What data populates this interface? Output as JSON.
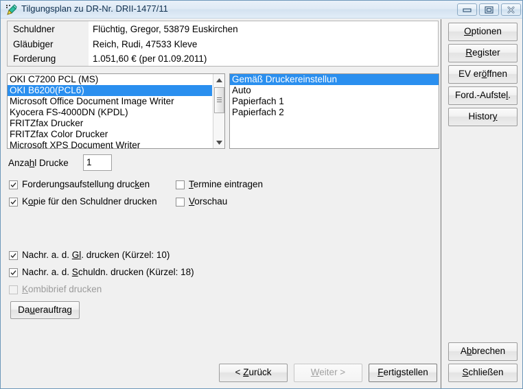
{
  "window": {
    "title": "Tilgungsplan zu DR-Nr. DRII-1477/11",
    "icon": "pen-tool-icon",
    "controls": {
      "minimize": "minimize-icon",
      "maximize": "maximize-icon",
      "close": "close-icon"
    }
  },
  "header": {
    "rows": [
      {
        "label": "Schuldner",
        "value": "Flüchtig, Gregor, 53879 Euskirchen"
      },
      {
        "label": "Gläubiger",
        "value": "Reich, Rudi, 47533 Kleve"
      },
      {
        "label": "Forderung",
        "value": "1.051,60 € (per 01.09.2011)"
      }
    ]
  },
  "printer_list": {
    "items": [
      "OKI C7200 PCL (MS)",
      "OKI B6200(PCL6)",
      "Microsoft Office Document Image Writer",
      "Kyocera FS-4000DN (KPDL)",
      "FRITZfax Drucker",
      "FRITZfax Color Drucker",
      "Microsoft XPS Document Writer"
    ],
    "selected_index": 1,
    "scrollbar": {
      "up_icon": "scroll-up-arrow-icon",
      "down_icon": "scroll-down-arrow-icon"
    }
  },
  "tray_list": {
    "items": [
      "Gemäß Druckereinstellun",
      "Auto",
      "Papierfach 1",
      "Papierfach 2"
    ],
    "selected_index": 0
  },
  "copies": {
    "label_pre": "Anza",
    "label_accel": "h",
    "label_post": "l Drucke",
    "value": "1"
  },
  "checkboxes": {
    "forderungsaufstellung": {
      "pre": "Forderungsaufstellung druc",
      "accel": "k",
      "post": "en",
      "checked": true,
      "disabled": false
    },
    "kopie_schuldner": {
      "pre": "K",
      "accel": "o",
      "post": "pie für den Schuldner drucken",
      "checked": true,
      "disabled": false
    },
    "termine_eintragen": {
      "pre": "",
      "accel": "T",
      "post": "ermine eintragen",
      "checked": false,
      "disabled": false
    },
    "vorschau": {
      "pre": "",
      "accel": "V",
      "post": "orschau",
      "checked": false,
      "disabled": false
    },
    "nachr_gl": {
      "pre": "Nachr. a. d. ",
      "accel": "Gl",
      "post": ". drucken (Kürzel: 10)",
      "checked": true,
      "disabled": false
    },
    "nachr_schuldn": {
      "pre": "Nachr. a. d. ",
      "accel": "S",
      "post": "chuldn. drucken (Kürzel: 18)",
      "checked": true,
      "disabled": false
    },
    "kombibrief": {
      "pre": "",
      "accel": "K",
      "post": "ombibrief drucken",
      "checked": false,
      "disabled": true
    }
  },
  "dauerauftrag": {
    "pre": "Da",
    "accel": "u",
    "post": "erauftrag"
  },
  "sidebar": {
    "buttons": [
      {
        "pre": "",
        "accel": "O",
        "post": "ptionen",
        "disabled": false
      },
      {
        "pre": "",
        "accel": "R",
        "post": "egister",
        "disabled": false
      },
      {
        "pre": "EV er",
        "accel": "ö",
        "post": "ffnen",
        "disabled": false
      },
      {
        "pre": "Ford.-Aufste",
        "accel": "l",
        "post": ".",
        "disabled": false
      },
      {
        "pre": "Histor",
        "accel": "y",
        "post": "",
        "disabled": false
      }
    ],
    "bottom_buttons": [
      {
        "pre": "A",
        "accel": "b",
        "post": "brechen",
        "disabled": false
      },
      {
        "pre": "",
        "accel": "S",
        "post": "chließen",
        "disabled": false
      }
    ]
  },
  "nav_buttons": [
    {
      "pre": "< ",
      "accel": "Z",
      "post": "urück",
      "disabled": false,
      "default": false
    },
    {
      "pre": "",
      "accel": "W",
      "post": "eiter >",
      "disabled": true,
      "default": false
    },
    {
      "pre": "",
      "accel": "F",
      "post": "ertigstellen",
      "disabled": false,
      "default": true
    }
  ],
  "colors": {
    "selection": "#2a8fef",
    "window_bg": "#f0f0f0",
    "panel_bg": "#ffffff",
    "title_text": "#10304f",
    "disabled_text": "#a0a0a0"
  }
}
